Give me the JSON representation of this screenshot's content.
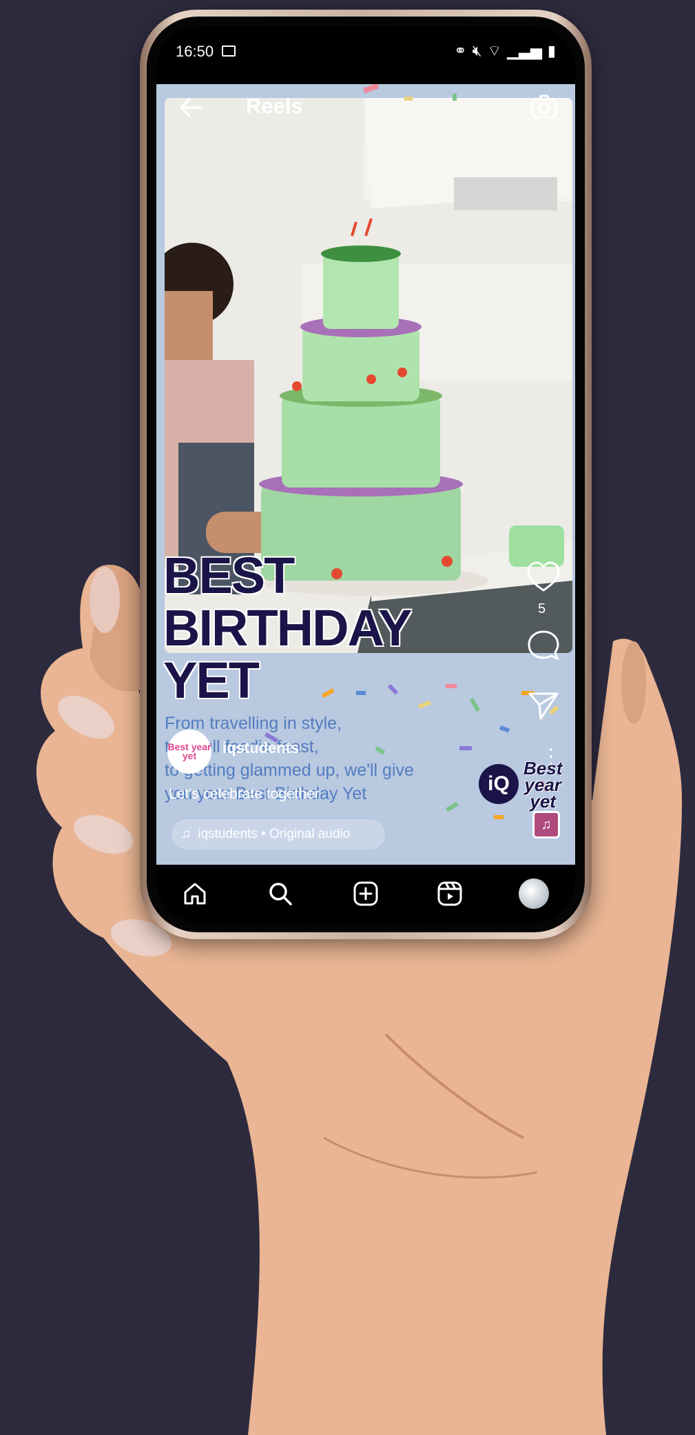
{
  "status_bar": {
    "time": "16:50"
  },
  "header": {
    "title": "Reels"
  },
  "reel": {
    "headline_lines": [
      "BEST",
      "BIRTHDAY",
      "YET"
    ],
    "promo_text_lines": [
      "From travelling in style,",
      "to a full foodie feast,",
      "to getting glammed up, we'll give",
      "you your Best Birthday Yet"
    ],
    "username": "iqstudents",
    "caption": "Let's celebrate together",
    "audio": "iqstudents • Original audio",
    "like_count": "5",
    "badge_text": "Best year yet",
    "brand_logo": "iQ",
    "brand_tagline_lines": [
      "Best",
      "year",
      "yet"
    ]
  },
  "icons": {
    "back": "arrow-left-icon",
    "camera": "camera-icon",
    "like": "heart-icon",
    "comment": "comment-icon",
    "share": "send-icon",
    "more": "more-icon",
    "music": "music-note-icon"
  },
  "nav": [
    "home-icon",
    "search-icon",
    "create-icon",
    "reels-icon",
    "profile-avatar"
  ],
  "colors": {
    "brand_navy": "#1b1448",
    "background": "#2d2a3e"
  }
}
